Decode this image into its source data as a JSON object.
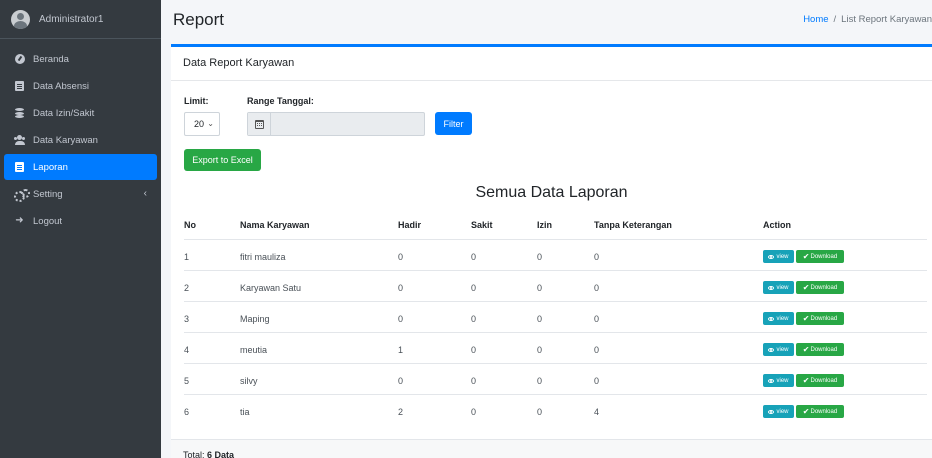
{
  "user": {
    "name": "Administrator1"
  },
  "sidebar": {
    "items": [
      {
        "label": "Beranda",
        "icon": "dashboard-icon"
      },
      {
        "label": "Data Absensi",
        "icon": "document-icon"
      },
      {
        "label": "Data Izin/Sakit",
        "icon": "database-icon"
      },
      {
        "label": "Data Karyawan",
        "icon": "users-icon"
      },
      {
        "label": "Laporan",
        "icon": "document-icon",
        "active": true
      },
      {
        "label": "Setting",
        "icon": "cogs-icon",
        "chevron": "‹"
      },
      {
        "label": "Logout",
        "icon": "logout-icon"
      }
    ]
  },
  "header": {
    "title": "Report",
    "breadcrumb": {
      "home": "Home",
      "separator": "/",
      "current": "List Report Karyawan"
    }
  },
  "card": {
    "title": "Data Report Karyawan"
  },
  "filters": {
    "limit_label": "Limit:",
    "limit_value": "20",
    "range_label": "Range Tanggal:",
    "range_value": "",
    "filter_button": "Filter",
    "export_button": "Export to Excel"
  },
  "table": {
    "caption": "Semua Data Laporan",
    "headers": [
      "No",
      "Nama Karyawan",
      "Hadir",
      "Sakit",
      "Izin",
      "Tanpa Keterangan",
      "Action"
    ],
    "rows": [
      {
        "no": "1",
        "nama": "fitri mauliza",
        "hadir": "0",
        "sakit": "0",
        "izin": "0",
        "tanpa": "0"
      },
      {
        "no": "2",
        "nama": "Karyawan Satu",
        "hadir": "0",
        "sakit": "0",
        "izin": "0",
        "tanpa": "0"
      },
      {
        "no": "3",
        "nama": "Maping",
        "hadir": "0",
        "sakit": "0",
        "izin": "0",
        "tanpa": "0"
      },
      {
        "no": "4",
        "nama": "meutia",
        "hadir": "1",
        "sakit": "0",
        "izin": "0",
        "tanpa": "0"
      },
      {
        "no": "5",
        "nama": "silvy",
        "hadir": "0",
        "sakit": "0",
        "izin": "0",
        "tanpa": "0"
      },
      {
        "no": "6",
        "nama": "tia",
        "hadir": "2",
        "sakit": "0",
        "izin": "0",
        "tanpa": "4"
      }
    ],
    "view_label": "view",
    "download_label": "Download"
  },
  "footer": {
    "total_prefix": "Total:",
    "total_value": "6 Data"
  },
  "colors": {
    "primary": "#007bff",
    "success": "#28a745",
    "info": "#17a2b8",
    "sidebar": "#343a40"
  }
}
